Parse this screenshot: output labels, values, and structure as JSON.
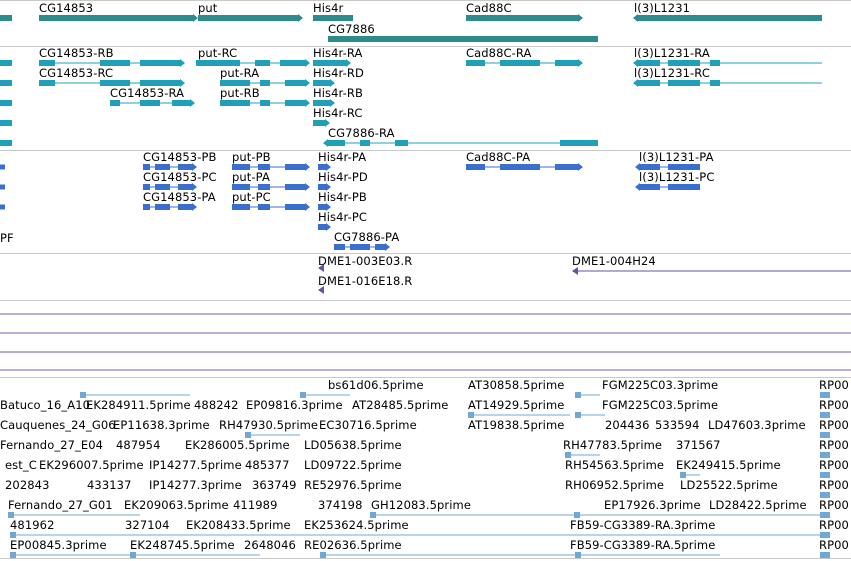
{
  "colors": {
    "gene": "#2e8b8b",
    "mrna": "#1fa0b8",
    "cds": "#3a6fd0",
    "probe": "#6a4fa8",
    "line": "#7a5ab0",
    "est": "#6fa8d6",
    "separator": "#c8c8c8"
  },
  "tracks": {
    "genes": {
      "labels": [
        "CG14853",
        "put",
        "His4r",
        "Cad88C",
        "l(3)L1231",
        "CG7886"
      ]
    },
    "transcripts": {
      "labels": [
        "CG14853-RB",
        "put-RC",
        "His4r-RA",
        "Cad88C-RA",
        "l(3)L1231-RA",
        "CG14853-RC",
        "put-RA",
        "His4r-RD",
        "l(3)L1231-RC",
        "CG14853-RA",
        "put-RB",
        "His4r-RB",
        "His4r-RC",
        "CG7886-RA"
      ]
    },
    "cds": {
      "edge_label": "PF",
      "labels": [
        "CG14853-PB",
        "put-PB",
        "His4r-PA",
        "Cad88C-PA",
        "l(3)L1231-PA",
        "CG14853-PC",
        "put-PA",
        "His4r-PD",
        "l(3)L1231-PC",
        "CG14853-PA",
        "put-PC",
        "His4r-PB",
        "His4r-PC",
        "CG7886-PA"
      ]
    },
    "clones": {
      "labels": [
        "DME1-003E03.R",
        "DME1-004H24",
        "DME1-016E18.R"
      ]
    },
    "ests": {
      "labels": [
        "bs61d06.5prime",
        "AT30858.5prime",
        "FGM225C03.3prime",
        "RP00",
        "Batuco_16_A10",
        "EK284911.5prime",
        "488242",
        "EP09816.3prime",
        "AT28485.5prime",
        "AT14929.5prime",
        "FGM225C03.5prime",
        "RP00",
        "Cauquenes_24_G06",
        "EP11638.3prime",
        "RH47930.5prime",
        "EC30716.5prime",
        "AT19838.5prime",
        "204436",
        "533594",
        "LD47603.3prime",
        "RP00",
        "Fernando_27_E04",
        "487954",
        "EK286005.5prime",
        "LD05638.5prime",
        "RH47783.5prime",
        "371567",
        "RP00",
        "est_C",
        "EK296007.5prime",
        "IP14277.5prime",
        "485377",
        "LD09722.5prime",
        "RH54563.5prime",
        "EK249415.5prime",
        "RP00",
        "202843",
        "433137",
        "IP14277.3prime",
        "363749",
        "RE52976.5prime",
        "RH06952.5prime",
        "LD25522.5prime",
        "RP00",
        "Fernando_27_G01",
        "EK209063.5prime",
        "411989",
        "374198",
        "GH12083.5prime",
        "EP17926.3prime",
        "LD28422.5prime",
        "RP00",
        "481962",
        "327104",
        "EK208433.5prime",
        "EK253624.5prime",
        "FB59-CG3389-RA.3prime",
        "RP00",
        "EP00845.3prime",
        "EK248745.5prime",
        "2648046",
        "RE02636.5prime",
        "FB59-CG3389-RA.5prime",
        "RP00"
      ]
    }
  }
}
